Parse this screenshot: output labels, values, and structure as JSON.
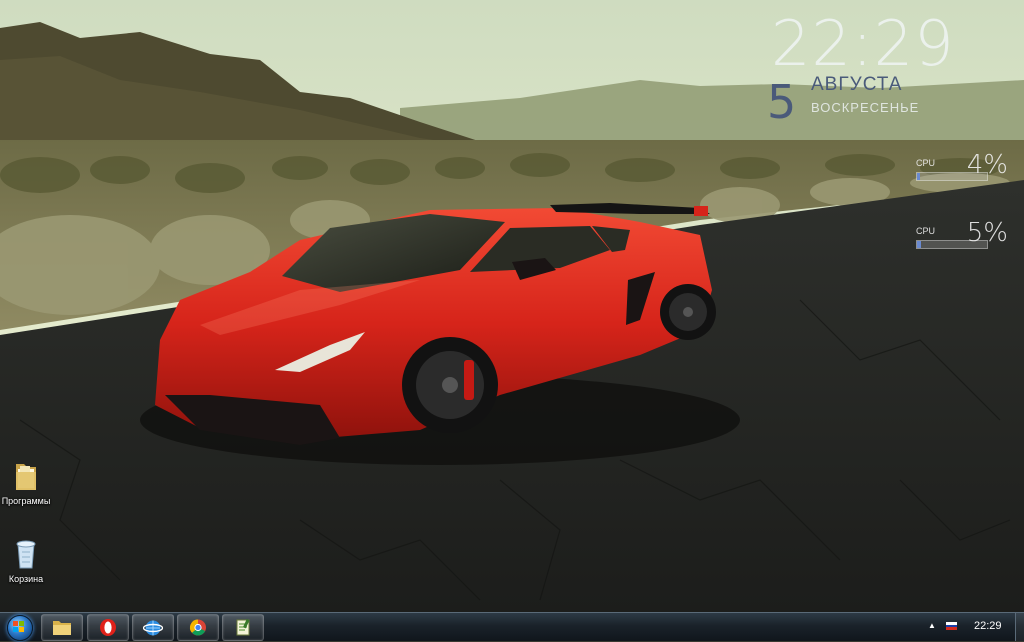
{
  "clock_gadget": {
    "time": "22:29",
    "day": "5",
    "month": "АВГУСТА",
    "weekday": "ВОСКРЕСЕНЬЕ"
  },
  "cpu_gadgets": [
    {
      "label": "CPU",
      "value": "4%",
      "level": 0.04
    },
    {
      "label": "CPU",
      "value": "5%",
      "level": 0.05
    }
  ],
  "desktop_icons": [
    {
      "name": "Программы",
      "icon": "folder-icon"
    },
    {
      "name": "Корзина",
      "icon": "recycle-bin-icon"
    }
  ],
  "taskbar": {
    "pinned": [
      {
        "app": "explorer",
        "icon": "folder-icon"
      },
      {
        "app": "opera",
        "icon": "opera-icon"
      },
      {
        "app": "internet-explorer",
        "icon": "browser-globe-icon"
      },
      {
        "app": "chrome",
        "icon": "chrome-icon"
      },
      {
        "app": "notepad",
        "icon": "notepad-icon"
      }
    ],
    "tray": {
      "arrow": "▲",
      "language_flag": "ru-flag-icon",
      "time": "22:29"
    }
  },
  "colors": {
    "car": "#d8261c",
    "taskbar": "#1a222a",
    "sky": "#dfe7c7"
  }
}
